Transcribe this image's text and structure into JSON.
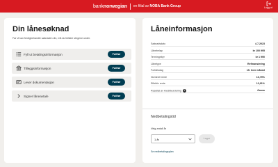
{
  "header": {
    "brand_bank": "bank",
    "brand_name": "norwegian",
    "sub_prefix": "en filial av ",
    "sub_company": "NOBA Bank Group",
    "logout_label": "Logg ut",
    "color": "#d71a21"
  },
  "application": {
    "title": "Din lånesøknad",
    "subtitle": "Før vi kan ferdigbehandle søknaden din, må du fullføre stegene under.",
    "steps": [
      {
        "label": "Fyll ut betalingsinformasjon",
        "button": "Fullfør",
        "icon": "list-icon"
      },
      {
        "label": "Tilleggsinformasjon",
        "button": "Fullfør",
        "icon": "bank-icon"
      },
      {
        "label": "Lever dokumentasjon",
        "button": "Fullfør",
        "icon": "document-icon"
      },
      {
        "label": "Signer låneavtale",
        "button": "Fullfør",
        "icon": "chevron-right-icon"
      }
    ]
  },
  "loan_info": {
    "title": "Låneinformasjon",
    "rows": [
      {
        "label": "Søknadsdato",
        "value": "4.7.2023"
      },
      {
        "label": "Lånebeløp",
        "value": "kr 100 995"
      },
      {
        "label": "Termingebyr",
        "value": "kr 1 990"
      },
      {
        "label": "Lånetype",
        "value": "Refinansiering"
      },
      {
        "label": "Forfallsdag",
        "value": "15. hver måned"
      },
      {
        "label": "Nominell rente",
        "value": "16,79%"
      },
      {
        "label": "Effektiv rente",
        "value": "13,61%"
      },
      {
        "label": "Resultat av kredittvurdering",
        "value": "Grønn"
      }
    ]
  },
  "down_payment": {
    "title": "Nedbetalingstid",
    "field_label": "Velg antall år",
    "selected": "1 år",
    "save_button": "Lagre",
    "link": "Se nedbetalingsplan"
  },
  "colors": {
    "accent": "#d71a21",
    "button": "#003d52",
    "background": "#f1efec"
  }
}
